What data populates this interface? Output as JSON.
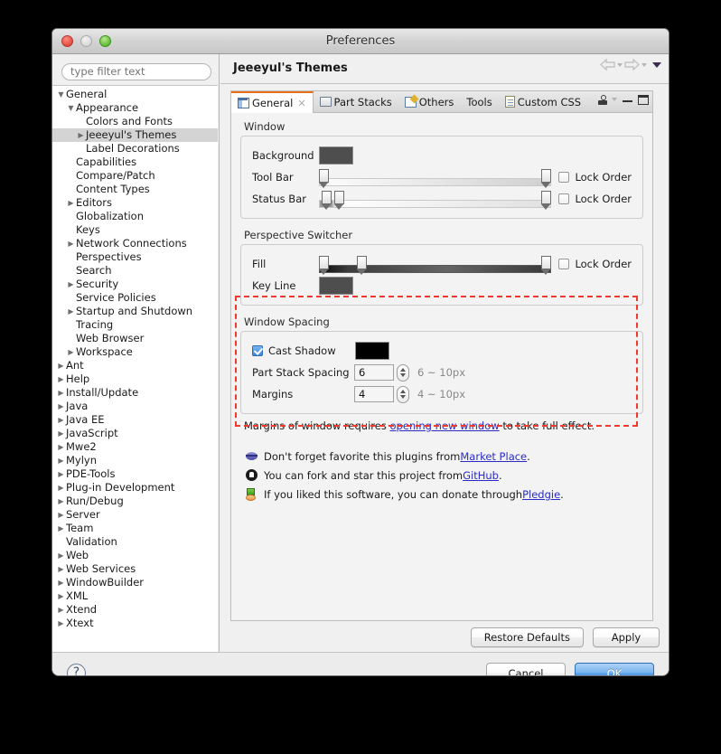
{
  "window": {
    "title": "Preferences",
    "traffic": {
      "close": "close-button",
      "minimize": "minimize-button",
      "maximize": "maximize-button"
    }
  },
  "sidebar": {
    "filter": {
      "placeholder": "type filter text",
      "value": ""
    },
    "tree": [
      {
        "label": "General",
        "indent": 0,
        "twisty": "down",
        "selected": false
      },
      {
        "label": "Appearance",
        "indent": 1,
        "twisty": "down",
        "selected": false
      },
      {
        "label": "Colors and Fonts",
        "indent": 2,
        "twisty": "none",
        "selected": false
      },
      {
        "label": "Jeeeyul's Themes",
        "indent": 2,
        "twisty": "right",
        "selected": true
      },
      {
        "label": "Label Decorations",
        "indent": 2,
        "twisty": "none",
        "selected": false
      },
      {
        "label": "Capabilities",
        "indent": 1,
        "twisty": "none",
        "selected": false
      },
      {
        "label": "Compare/Patch",
        "indent": 1,
        "twisty": "none",
        "selected": false
      },
      {
        "label": "Content Types",
        "indent": 1,
        "twisty": "none",
        "selected": false
      },
      {
        "label": "Editors",
        "indent": 1,
        "twisty": "right",
        "selected": false
      },
      {
        "label": "Globalization",
        "indent": 1,
        "twisty": "none",
        "selected": false
      },
      {
        "label": "Keys",
        "indent": 1,
        "twisty": "none",
        "selected": false
      },
      {
        "label": "Network Connections",
        "indent": 1,
        "twisty": "right",
        "selected": false
      },
      {
        "label": "Perspectives",
        "indent": 1,
        "twisty": "none",
        "selected": false
      },
      {
        "label": "Search",
        "indent": 1,
        "twisty": "none",
        "selected": false
      },
      {
        "label": "Security",
        "indent": 1,
        "twisty": "right",
        "selected": false
      },
      {
        "label": "Service Policies",
        "indent": 1,
        "twisty": "none",
        "selected": false
      },
      {
        "label": "Startup and Shutdown",
        "indent": 1,
        "twisty": "right",
        "selected": false
      },
      {
        "label": "Tracing",
        "indent": 1,
        "twisty": "none",
        "selected": false
      },
      {
        "label": "Web Browser",
        "indent": 1,
        "twisty": "none",
        "selected": false
      },
      {
        "label": "Workspace",
        "indent": 1,
        "twisty": "right",
        "selected": false
      },
      {
        "label": "Ant",
        "indent": 0,
        "twisty": "right",
        "selected": false
      },
      {
        "label": "Help",
        "indent": 0,
        "twisty": "right",
        "selected": false
      },
      {
        "label": "Install/Update",
        "indent": 0,
        "twisty": "right",
        "selected": false
      },
      {
        "label": "Java",
        "indent": 0,
        "twisty": "right",
        "selected": false
      },
      {
        "label": "Java EE",
        "indent": 0,
        "twisty": "right",
        "selected": false
      },
      {
        "label": "JavaScript",
        "indent": 0,
        "twisty": "right",
        "selected": false
      },
      {
        "label": "Mwe2",
        "indent": 0,
        "twisty": "right",
        "selected": false
      },
      {
        "label": "Mylyn",
        "indent": 0,
        "twisty": "right",
        "selected": false
      },
      {
        "label": "PDE-Tools",
        "indent": 0,
        "twisty": "right",
        "selected": false
      },
      {
        "label": "Plug-in Development",
        "indent": 0,
        "twisty": "right",
        "selected": false
      },
      {
        "label": "Run/Debug",
        "indent": 0,
        "twisty": "right",
        "selected": false
      },
      {
        "label": "Server",
        "indent": 0,
        "twisty": "right",
        "selected": false
      },
      {
        "label": "Team",
        "indent": 0,
        "twisty": "right",
        "selected": false
      },
      {
        "label": "Validation",
        "indent": 0,
        "twisty": "none",
        "selected": false
      },
      {
        "label": "Web",
        "indent": 0,
        "twisty": "right",
        "selected": false
      },
      {
        "label": "Web Services",
        "indent": 0,
        "twisty": "right",
        "selected": false
      },
      {
        "label": "WindowBuilder",
        "indent": 0,
        "twisty": "right",
        "selected": false
      },
      {
        "label": "XML",
        "indent": 0,
        "twisty": "right",
        "selected": false
      },
      {
        "label": "Xtend",
        "indent": 0,
        "twisty": "right",
        "selected": false
      },
      {
        "label": "Xtext",
        "indent": 0,
        "twisty": "right",
        "selected": false
      }
    ]
  },
  "page": {
    "title": "Jeeeyul's Themes",
    "nav": {
      "back": "back-arrow-icon",
      "forward": "forward-arrow-icon",
      "menu": "view-menu-icon"
    }
  },
  "tabs": [
    {
      "label": "General",
      "icon": "general-icon",
      "active": true,
      "closable": true
    },
    {
      "label": "Part Stacks",
      "icon": "part-stacks-icon",
      "active": false,
      "closable": false
    },
    {
      "label": "Others",
      "icon": "others-icon",
      "active": false,
      "closable": false
    },
    {
      "label": "Tools",
      "icon": "",
      "active": false,
      "closable": false
    },
    {
      "label": "Custom CSS",
      "icon": "custom-css-icon",
      "active": false,
      "closable": false
    }
  ],
  "tab_toolbar": {
    "hanger": "hanger-icon",
    "minimize": "minimize-icon",
    "maximize": "maximize-icon"
  },
  "groups": {
    "window": {
      "title": "Window",
      "background_label": "Background",
      "background_color": "#4e4e4e",
      "toolbar_label": "Tool Bar",
      "toolbar_lock_label": "Lock Order",
      "toolbar_lock_checked": false,
      "statusbar_label": "Status Bar",
      "statusbar_lock_label": "Lock Order",
      "statusbar_lock_checked": false
    },
    "perspective": {
      "title": "Perspective Switcher",
      "fill_label": "Fill",
      "fill_lock_label": "Lock Order",
      "fill_lock_checked": false,
      "keyline_label": "Key Line",
      "keyline_color": "#4e4e4e"
    },
    "spacing": {
      "title": "Window Spacing",
      "cast_shadow_label": "Cast Shadow",
      "cast_shadow_checked": true,
      "cast_shadow_color": "#000000",
      "part_stack_spacing_label": "Part Stack Spacing",
      "part_stack_spacing_value": "6",
      "part_stack_spacing_hint": "6 ~ 10px",
      "margins_label": "Margins",
      "margins_value": "4",
      "margins_hint": "4 ~ 10px",
      "note_prefix": "Margins of window requires ",
      "note_link": "opening new window",
      "note_suffix": " to take full effect."
    }
  },
  "highlight_color": "#ef3b2d",
  "info_lines": [
    {
      "icon": "marketplace-icon",
      "prefix": "Don't forget favorite this plugins from ",
      "link": "Market Place",
      "suffix": "."
    },
    {
      "icon": "github-icon",
      "prefix": "You can fork and star this project from ",
      "link": "GitHub",
      "suffix": "."
    },
    {
      "icon": "pledgie-icon",
      "prefix": "If you liked this software, you can donate through ",
      "link": "Pledgie",
      "suffix": "."
    }
  ],
  "apply_bar": {
    "restore_defaults": "Restore Defaults",
    "apply": "Apply"
  },
  "footer": {
    "help": "?",
    "cancel": "Cancel",
    "ok": "OK"
  }
}
